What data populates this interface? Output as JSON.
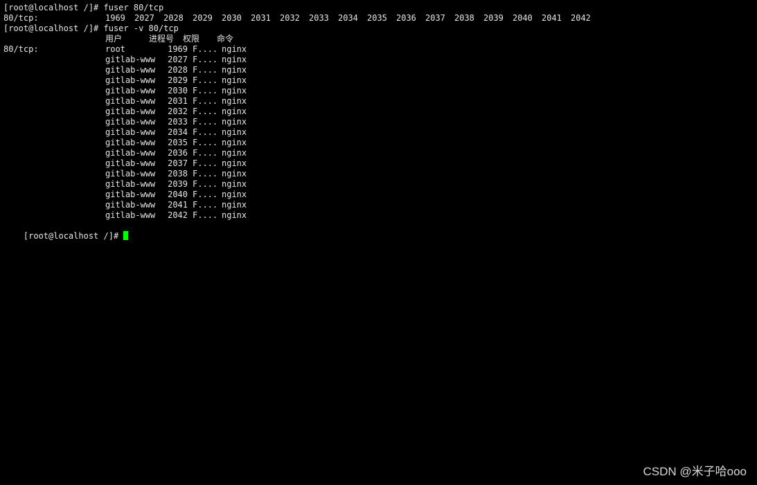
{
  "terminal": {
    "lines": {
      "cmd1": "[root@localhost /]# fuser 80/tcp",
      "out1_label": "80/tcp:",
      "out1_pids": [
        "1969",
        "2027",
        "2028",
        "2029",
        "2030",
        "2031",
        "2032",
        "2033",
        "2034",
        "2035",
        "2036",
        "2037",
        "2038",
        "2039",
        "2040",
        "2041",
        "2042"
      ],
      "cmd2": "[root@localhost /]# fuser -v 80/tcp",
      "header": {
        "user": "用户",
        "pid": "进程号",
        "access": "权限",
        "command": "命令"
      },
      "resource": "80/tcp:",
      "prompt_final": "[root@localhost /]# "
    },
    "processes": [
      {
        "user": "root",
        "pid": "1969",
        "access": "F....",
        "command": "nginx"
      },
      {
        "user": "gitlab-www",
        "pid": "2027",
        "access": "F....",
        "command": "nginx"
      },
      {
        "user": "gitlab-www",
        "pid": "2028",
        "access": "F....",
        "command": "nginx"
      },
      {
        "user": "gitlab-www",
        "pid": "2029",
        "access": "F....",
        "command": "nginx"
      },
      {
        "user": "gitlab-www",
        "pid": "2030",
        "access": "F....",
        "command": "nginx"
      },
      {
        "user": "gitlab-www",
        "pid": "2031",
        "access": "F....",
        "command": "nginx"
      },
      {
        "user": "gitlab-www",
        "pid": "2032",
        "access": "F....",
        "command": "nginx"
      },
      {
        "user": "gitlab-www",
        "pid": "2033",
        "access": "F....",
        "command": "nginx"
      },
      {
        "user": "gitlab-www",
        "pid": "2034",
        "access": "F....",
        "command": "nginx"
      },
      {
        "user": "gitlab-www",
        "pid": "2035",
        "access": "F....",
        "command": "nginx"
      },
      {
        "user": "gitlab-www",
        "pid": "2036",
        "access": "F....",
        "command": "nginx"
      },
      {
        "user": "gitlab-www",
        "pid": "2037",
        "access": "F....",
        "command": "nginx"
      },
      {
        "user": "gitlab-www",
        "pid": "2038",
        "access": "F....",
        "command": "nginx"
      },
      {
        "user": "gitlab-www",
        "pid": "2039",
        "access": "F....",
        "command": "nginx"
      },
      {
        "user": "gitlab-www",
        "pid": "2040",
        "access": "F....",
        "command": "nginx"
      },
      {
        "user": "gitlab-www",
        "pid": "2041",
        "access": "F....",
        "command": "nginx"
      },
      {
        "user": "gitlab-www",
        "pid": "2042",
        "access": "F....",
        "command": "nginx"
      }
    ],
    "colors": {
      "background": "#000000",
      "text": "#e6e6e6",
      "cursor": "#00ff00"
    }
  },
  "watermark": {
    "text": "CSDN @米子哈ooo"
  }
}
